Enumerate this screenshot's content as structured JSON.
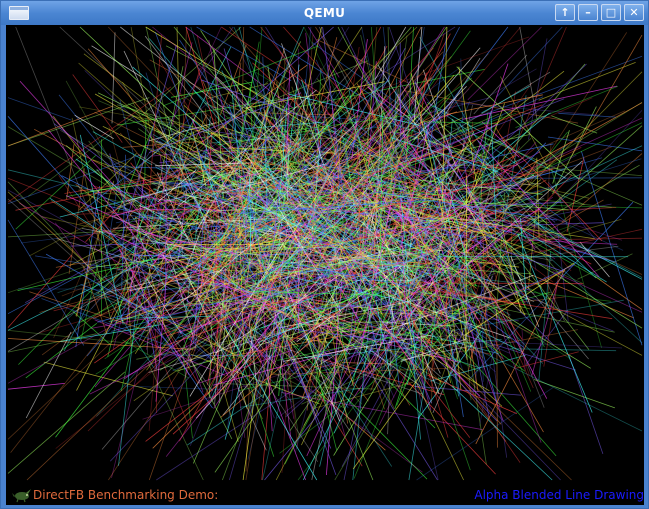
{
  "window": {
    "title": "QEMU",
    "icon": "window-icon",
    "controls": {
      "shade": "arrow-up-icon",
      "minimize": "minimize-icon",
      "maximize": "maximize-icon",
      "close": "close-icon"
    },
    "title_color": "#ffffff",
    "frame_color": "#4a82cf"
  },
  "demo": {
    "footer_left": "DirectFB Benchmarking Demo:",
    "footer_right": "Alpha Blended Line Drawing",
    "footer_left_color": "#e06a3c",
    "footer_right_color": "#1b1bff",
    "logo": "directfb-mascot-icon",
    "background": "#000000"
  }
}
